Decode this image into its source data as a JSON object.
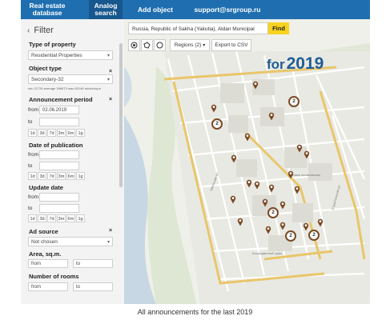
{
  "nav": {
    "items": [
      {
        "label": "Real estate database",
        "active": false
      },
      {
        "label": "Analog search",
        "active": true
      },
      {
        "label": "Add object",
        "active": false
      },
      {
        "label": "support@srgroup.ru",
        "active": false
      }
    ]
  },
  "filter": {
    "title": "Filter",
    "type_of_property": {
      "label": "Type of property",
      "value": "Residential Properties"
    },
    "object_type": {
      "label": "Object type",
      "value": "Secondary-32",
      "note": "min 21734 average 396673 max 82146 rubles/sq.m"
    },
    "announcement_period": {
      "label": "Announcement period",
      "from_label": "from",
      "from_value": "02.06.2019",
      "to_label": "to",
      "quick": [
        "1d",
        "3d",
        "7d",
        "3m",
        "6m",
        "1g"
      ]
    },
    "date_of_publication": {
      "label": "Date of publication",
      "from_label": "from",
      "to_label": "to",
      "quick": [
        "1d",
        "3d",
        "7d",
        "3m",
        "6m",
        "1g"
      ]
    },
    "update_date": {
      "label": "Update date",
      "from_label": "from",
      "to_label": "to",
      "quick": [
        "1d",
        "3d",
        "7d",
        "3m",
        "6m",
        "1g"
      ]
    },
    "ad_source": {
      "label": "Ad source",
      "value": "Not chosen"
    },
    "area": {
      "label": "Area, sq.m.",
      "from_placeholder": "from",
      "to_placeholder": "to"
    },
    "rooms": {
      "label": "Number of rooms",
      "from_placeholder": "from",
      "to_placeholder": "to"
    },
    "clear_symbol": "×"
  },
  "map": {
    "address": "Russia, Republic of Sakha (Yakutia), Aldan Municipal",
    "find_label": "Find",
    "regions_label": "Regions (2)",
    "export_label": "Export to CSV",
    "headline_for": "for",
    "headline_year": "2019",
    "poi_labels": [
      "Детская поликлиника",
      "Богородичный храм",
      "Школьная ул.",
      "Строительная ул."
    ],
    "markers": [
      {
        "kind": "pin"
      },
      {
        "kind": "pin"
      },
      {
        "kind": "pin"
      },
      {
        "kind": "pin"
      },
      {
        "kind": "pin"
      },
      {
        "kind": "pin"
      },
      {
        "kind": "pin"
      },
      {
        "kind": "pin"
      },
      {
        "kind": "pin"
      },
      {
        "kind": "pin"
      },
      {
        "kind": "pin"
      },
      {
        "kind": "pin"
      },
      {
        "kind": "pin"
      },
      {
        "kind": "pin"
      },
      {
        "kind": "pin"
      },
      {
        "kind": "pin"
      },
      {
        "kind": "pin"
      },
      {
        "kind": "pin"
      },
      {
        "kind": "pin"
      },
      {
        "kind": "pin"
      },
      {
        "kind": "cluster",
        "count": "2"
      },
      {
        "kind": "cluster",
        "count": "2"
      },
      {
        "kind": "cluster",
        "count": "2"
      },
      {
        "kind": "cluster",
        "count": "2"
      },
      {
        "kind": "cluster",
        "count": "2"
      }
    ],
    "colors": {
      "marker": "#7a4a24",
      "highlight_road": "#e8c66a"
    }
  },
  "caption": "All announcements for the last 2019"
}
